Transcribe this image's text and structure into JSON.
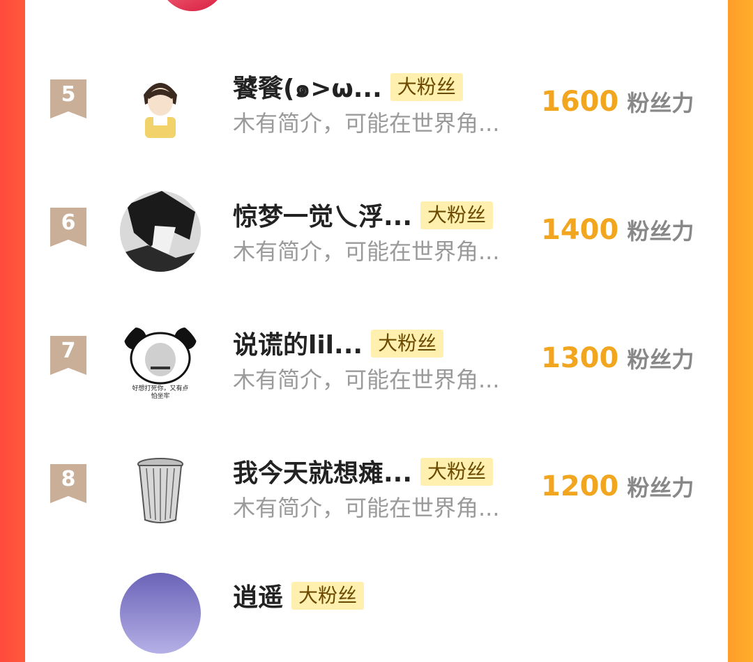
{
  "unit_label": "粉丝力",
  "rows": [
    {
      "rank": "5",
      "name": "饕餮(๑>ω...",
      "badge": "大粉丝",
      "bio": "木有简介，可能在世界角...",
      "score": "1600",
      "avatar_icon": "anime-boy-avatar"
    },
    {
      "rank": "6",
      "name": "惊梦一觉乀浮...",
      "badge": "大粉丝",
      "bio": "木有简介，可能在世界角...",
      "score": "1400",
      "avatar_icon": "dark-hair-avatar"
    },
    {
      "rank": "7",
      "name": "说谎的lil...",
      "badge": "大粉丝",
      "bio": "木有简介，可能在世界角...",
      "score": "1300",
      "avatar_icon": "panda-meme-avatar",
      "avatar_text": "好想打死你，又有点\n怕坐牢"
    },
    {
      "rank": "8",
      "name": "我今天就想瘫...",
      "badge": "大粉丝",
      "bio": "木有简介，可能在世界角...",
      "score": "1200",
      "avatar_icon": "trash-can-avatar"
    }
  ],
  "partial_row": {
    "name": "逍遥",
    "badge": "大粉丝"
  },
  "colors": {
    "accent_left": "#ff4a3d",
    "accent_right": "#ffae2a",
    "score": "#f2a51f",
    "rank_ribbon": "#c9ae98",
    "badge_bg": "#fff0b0"
  }
}
